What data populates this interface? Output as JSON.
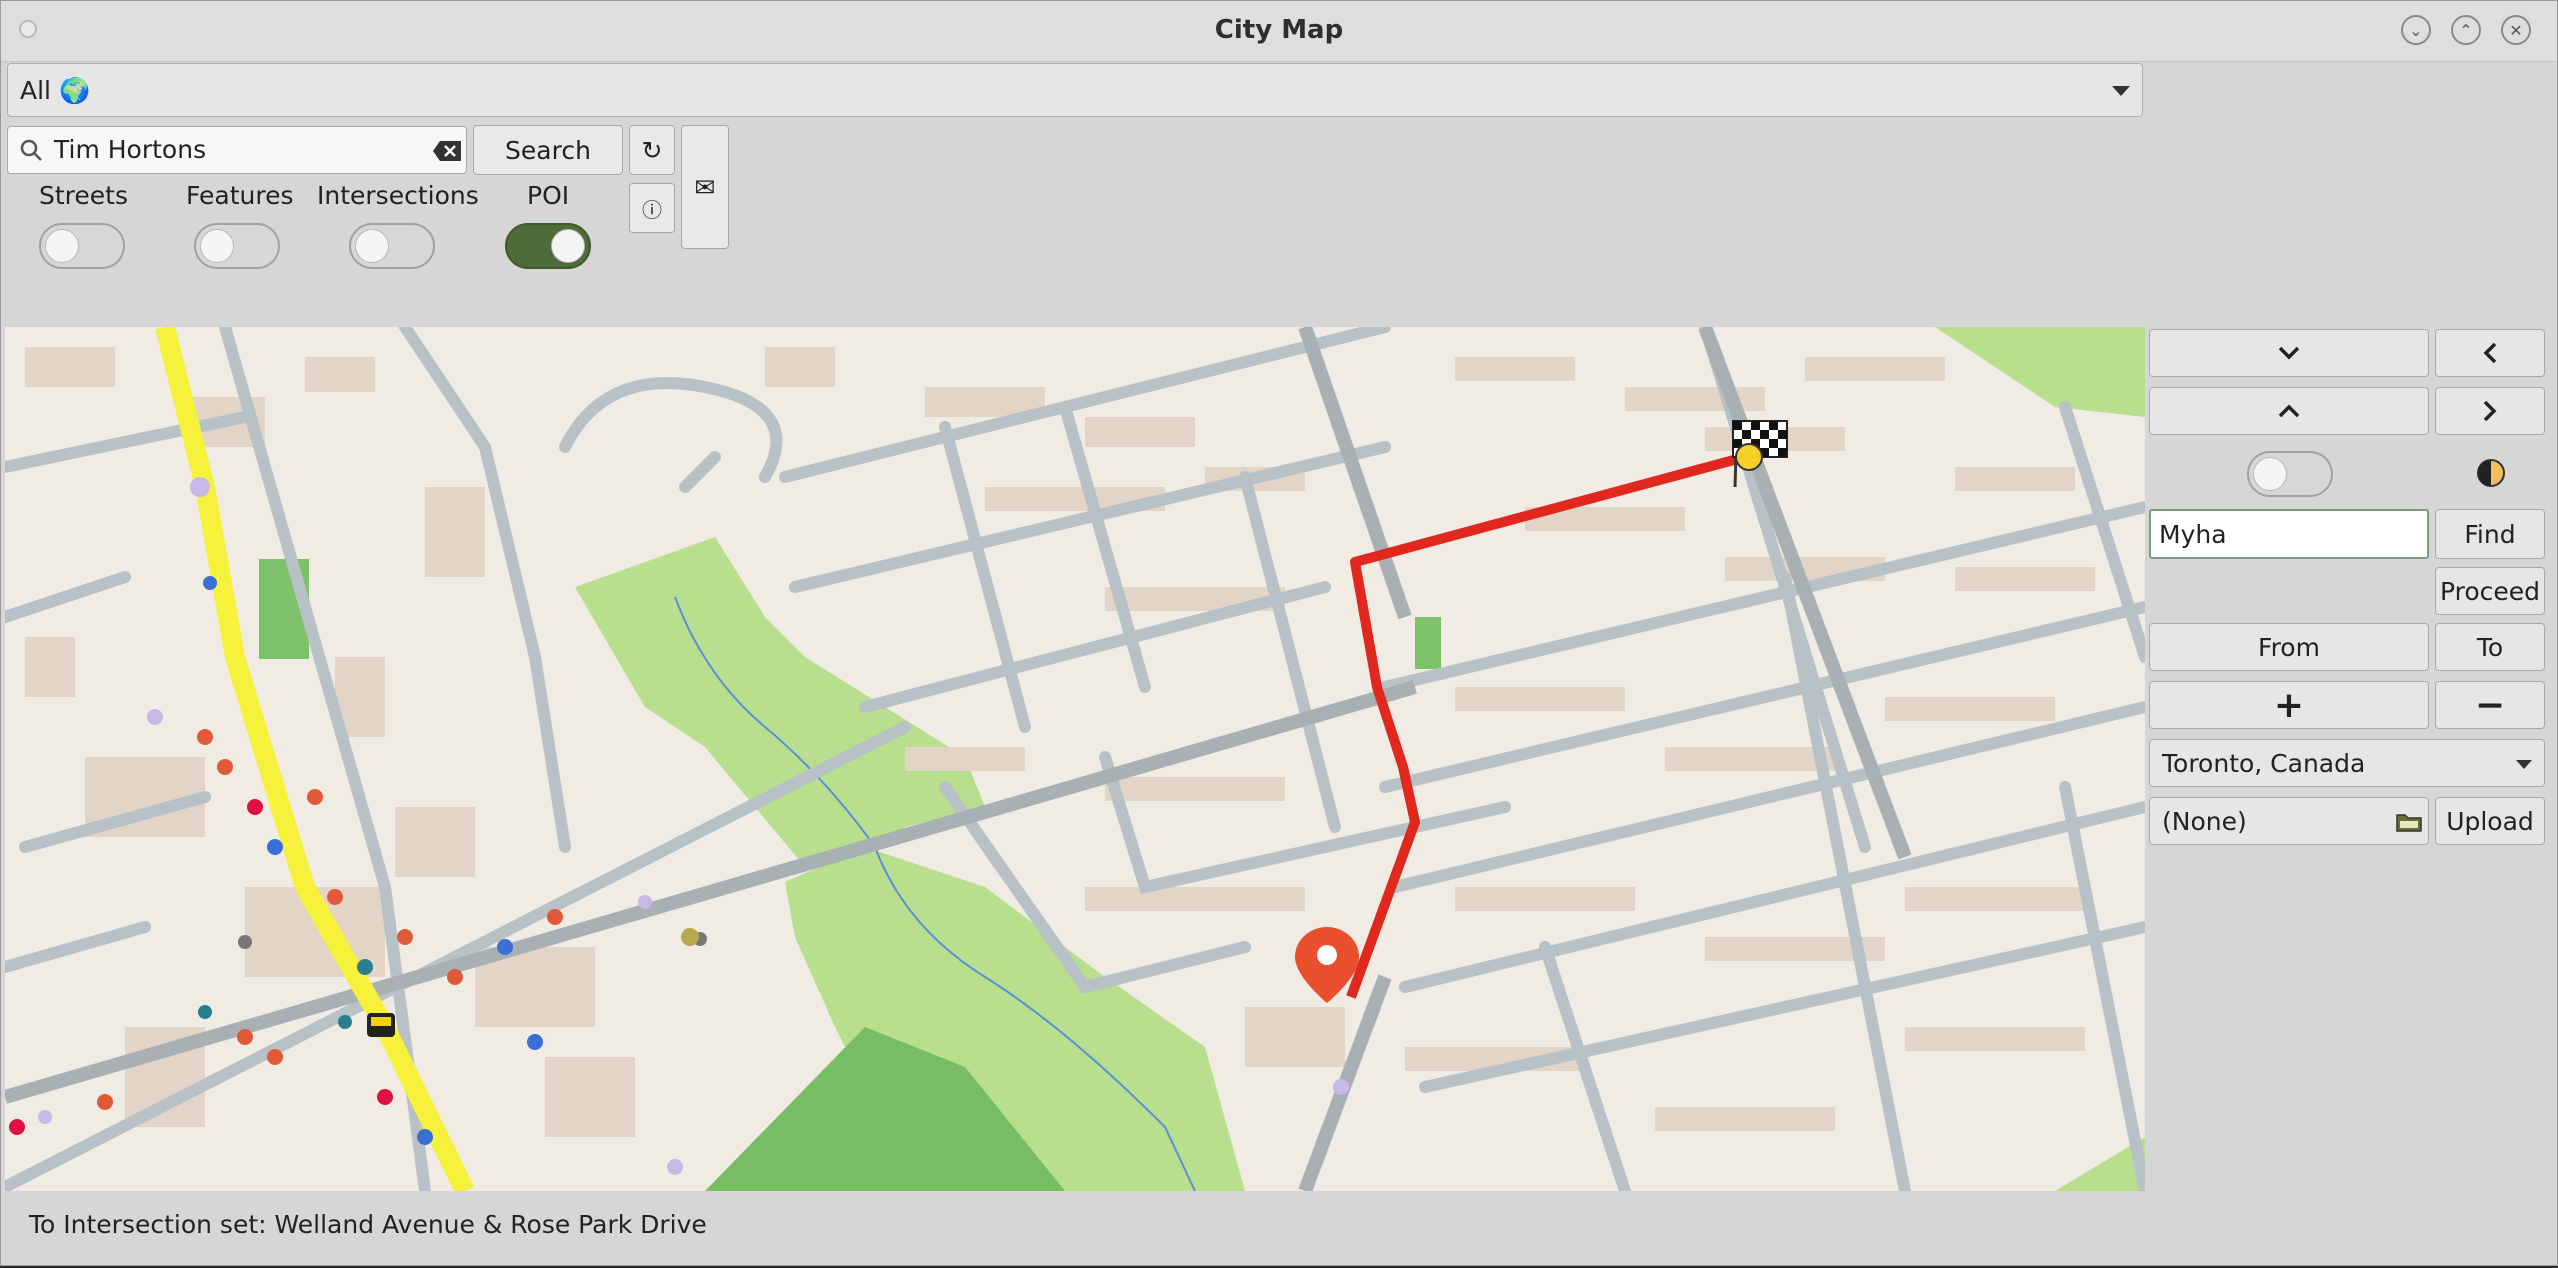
{
  "window": {
    "title": "City Map"
  },
  "region_selector": {
    "value": "All 🌍"
  },
  "search": {
    "value": "Tim Hortons",
    "button_label": "Search"
  },
  "toggles": [
    {
      "label": "Streets",
      "on": false
    },
    {
      "label": "Features",
      "on": false
    },
    {
      "label": "Intersections",
      "on": false
    },
    {
      "label": "POI",
      "on": true
    }
  ],
  "icons": {
    "refresh": "↻",
    "info": "ⓘ",
    "mail": "✉"
  },
  "right_panel": {
    "find_input": "Myha",
    "find_label": "Find",
    "proceed_label": "Proceed",
    "from_label": "From",
    "to_label": "To",
    "zoom_in": "+",
    "zoom_out": "−",
    "city": "Toronto, Canada",
    "file": "(None)",
    "upload_label": "Upload",
    "night_mode_on": false
  },
  "status_bar": {
    "text": "To Intersection set: Welland Avenue & Rose Park Drive"
  },
  "colors": {
    "route": "#e0281e",
    "highway": "#f6f13a",
    "park": "#b6e08c",
    "toggle_on": "#4f6b3a",
    "map_bg": "#f0ece4"
  }
}
